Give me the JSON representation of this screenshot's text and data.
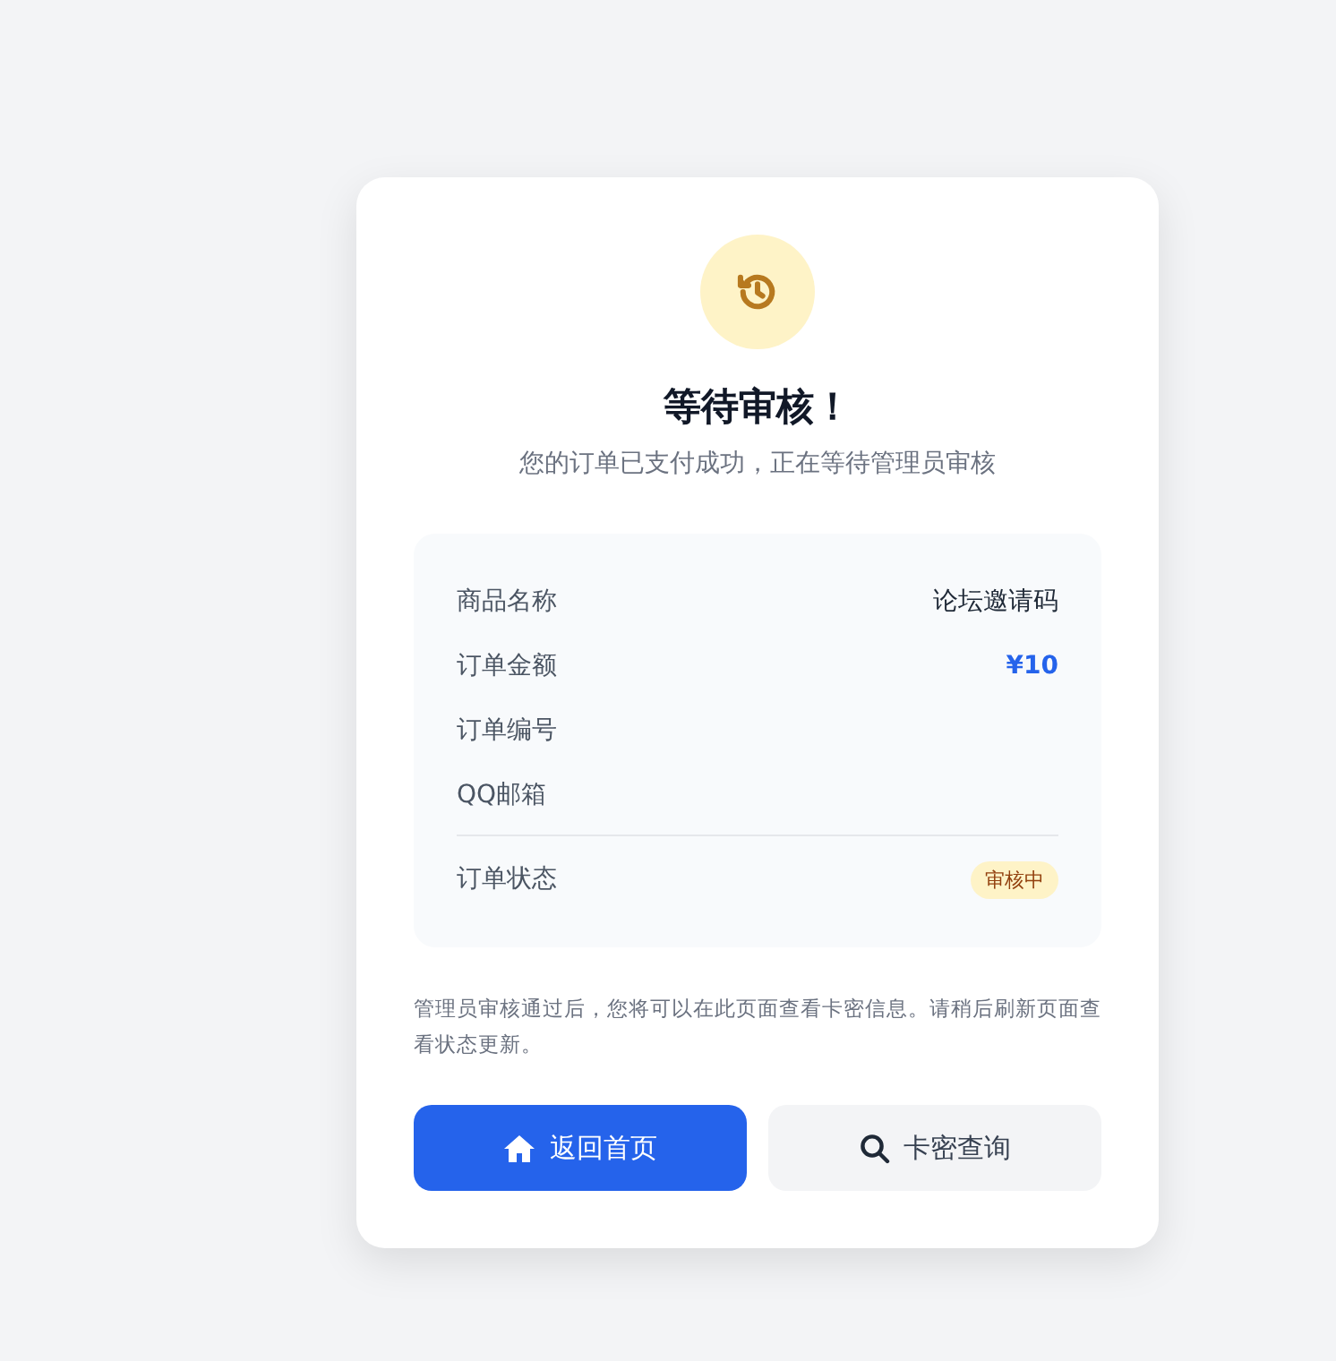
{
  "header": {
    "title": "等待审核！",
    "subtitle": "您的订单已支付成功，正在等待管理员审核"
  },
  "details": [
    {
      "label": "商品名称",
      "value": "论坛邀请码",
      "kind": "text"
    },
    {
      "label": "订单金额",
      "value": "¥10",
      "kind": "price"
    },
    {
      "label": "订单编号"
    },
    {
      "label": "QQ邮箱"
    }
  ],
  "status": {
    "label": "订单状态",
    "value": "审核中"
  },
  "note": "管理员审核通过后，您将可以在此页面查看卡密信息。请稍后刷新页面查看状态更新。",
  "buttons": [
    {
      "label": "返回首页",
      "kind": "primary"
    },
    {
      "label": "卡密查询",
      "kind": "secondary"
    }
  ]
}
